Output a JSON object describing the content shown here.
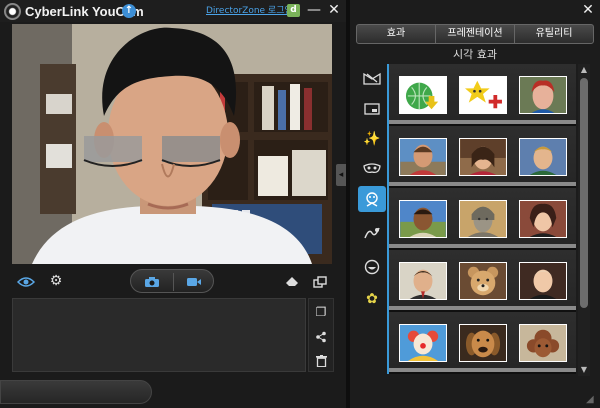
{
  "app": {
    "title": "CyberLink YouCam",
    "directorzone_link": "DirectorZone 로그인"
  },
  "window_buttons": {
    "minimize": "—",
    "close": "✕"
  },
  "controls": {
    "icons": [
      "eye-icon",
      "gear-icon",
      "camera-icon",
      "video-icon",
      "eraser-icon",
      "resize-icon"
    ]
  },
  "tray_tools": [
    "fullscreen-icon",
    "share-icon",
    "trash-icon"
  ],
  "right_panel": {
    "close": "✕",
    "tabs": [
      {
        "label": "효과"
      },
      {
        "label": "프레젠테이션"
      },
      {
        "label": "유틸리티"
      }
    ],
    "section_title": "시각 효과",
    "categories": [
      {
        "icon": "scene-icon"
      },
      {
        "icon": "frame-icon"
      },
      {
        "icon": "particle-icon"
      },
      {
        "icon": "mask-icon"
      },
      {
        "icon": "avatar-icon",
        "active": true
      },
      {
        "icon": "distortion-icon"
      },
      {
        "icon": "emotion-icon"
      },
      {
        "icon": "gadget-icon"
      }
    ],
    "scroll": {
      "up": "▲",
      "down": "▼"
    }
  }
}
